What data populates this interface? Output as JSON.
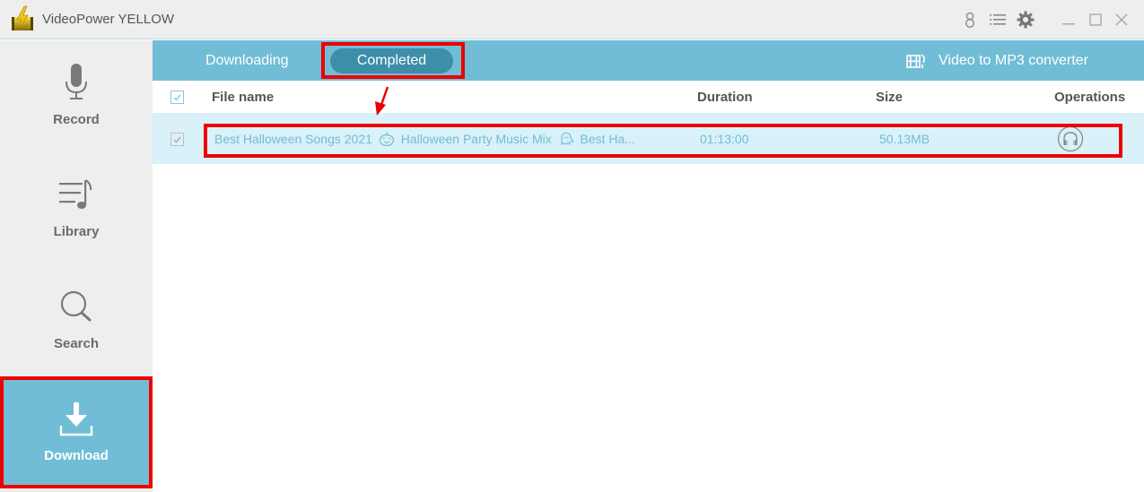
{
  "app": {
    "title": "VideoPower YELLOW",
    "logo_icon": "lightning-film-logo"
  },
  "titlebar": {
    "icons": [
      "user-icon",
      "menu-list-icon",
      "gear-icon",
      "minimize-icon",
      "maximize-icon",
      "close-icon"
    ]
  },
  "sidebar": {
    "items": [
      {
        "label": "Record",
        "icon": "microphone-icon",
        "active": false
      },
      {
        "label": "Library",
        "icon": "music-list-icon",
        "active": false
      },
      {
        "label": "Search",
        "icon": "search-icon",
        "active": false
      },
      {
        "label": "Download",
        "icon": "download-icon",
        "active": true
      }
    ]
  },
  "tabs": {
    "items": [
      {
        "label": "Downloading",
        "active": false
      },
      {
        "label": "Completed",
        "active": true
      }
    ],
    "converter_label": "Video to MP3 converter",
    "converter_icon": "film-music-icon"
  },
  "table": {
    "columns": [
      "File name",
      "Duration",
      "Size",
      "Operations"
    ],
    "rows": [
      {
        "checked": true,
        "file_name": "Best Halloween Songs 2021 🎃 Halloween Party Music Mix 👻 Best Ha...",
        "file_name_parts": [
          "Best Halloween Songs 2021",
          "Halloween Party Music Mix",
          "Best Ha..."
        ],
        "duration": "01:13:00",
        "size": "50.13MB",
        "operation_icon": "headphones-icon"
      }
    ]
  },
  "colors": {
    "accent": "#71bdd5",
    "active_tab": "#3d8ea8",
    "row_bg": "#d9f1f8",
    "row_text": "#72bcd4",
    "highlight": "#ee0000",
    "sidebar_bg": "#eeeeee"
  }
}
